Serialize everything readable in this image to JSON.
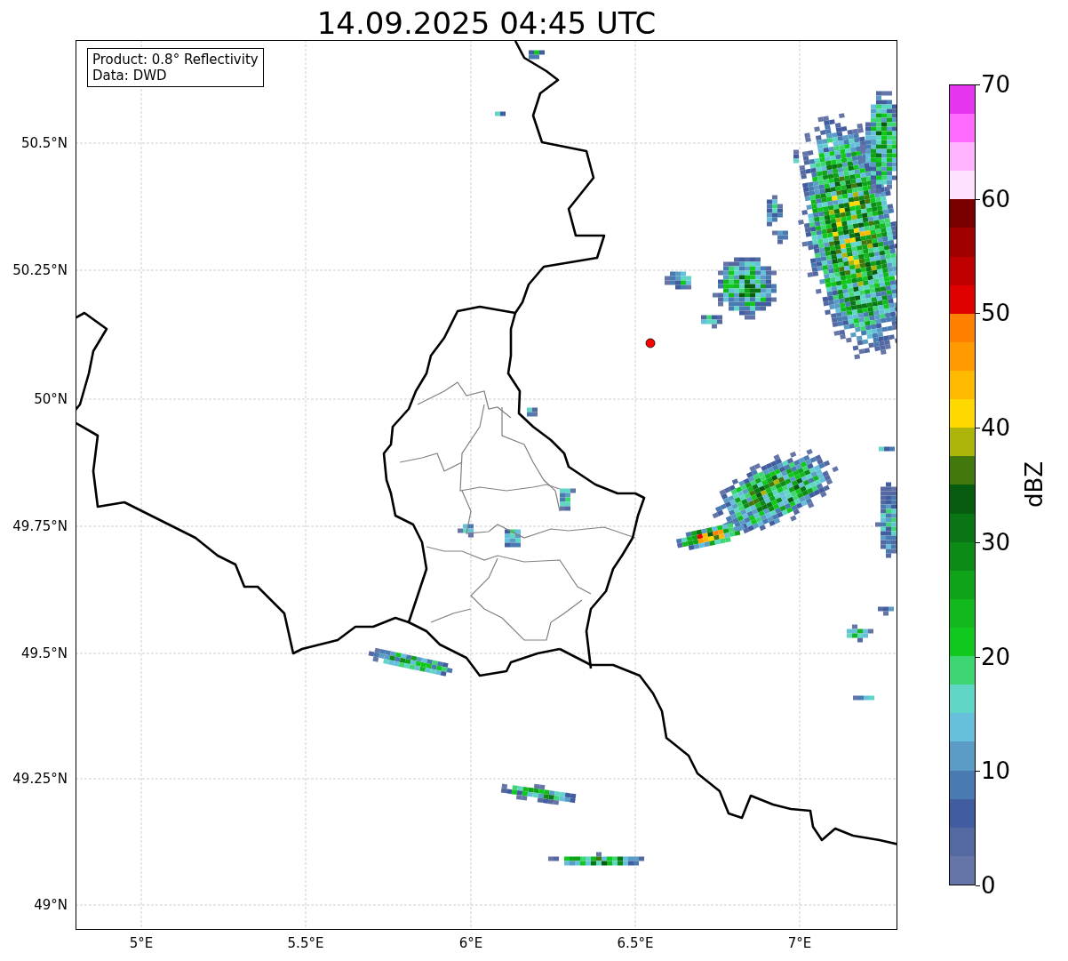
{
  "title": "14.09.2025 04:45 UTC",
  "info_box": {
    "lines": [
      "Product: 0.8° Reflectivity",
      "Data: DWD"
    ]
  },
  "map": {
    "x_ticks": [
      "5°E",
      "5.5°E",
      "6°E",
      "6.5°E",
      "7°E"
    ],
    "y_ticks": [
      "50.5°N",
      "50.25°N",
      "50°N",
      "49.75°N",
      "49.5°N",
      "49.25°N",
      "49°N"
    ]
  },
  "colorbar": {
    "label": "dBZ",
    "ticks": [
      "70",
      "60",
      "50",
      "40",
      "30",
      "20",
      "10",
      "0"
    ],
    "segments": [
      {
        "color": "#6675a8"
      },
      {
        "color": "#5468a2"
      },
      {
        "color": "#425ca0"
      },
      {
        "color": "#4a7ab2"
      },
      {
        "color": "#5b9cc6"
      },
      {
        "color": "#66c0dc"
      },
      {
        "color": "#5fd6c6"
      },
      {
        "color": "#3ed673"
      },
      {
        "color": "#11c81e"
      },
      {
        "color": "#12b81d"
      },
      {
        "color": "#0fa31a"
      },
      {
        "color": "#0c8c17"
      },
      {
        "color": "#0a7514"
      },
      {
        "color": "#075c10"
      },
      {
        "color": "#43780d"
      },
      {
        "color": "#adb40a"
      },
      {
        "color": "#ffd800"
      },
      {
        "color": "#ffb900"
      },
      {
        "color": "#ff9b00"
      },
      {
        "color": "#ff7f00"
      },
      {
        "color": "#e00000"
      },
      {
        "color": "#c00000"
      },
      {
        "color": "#a00000"
      },
      {
        "color": "#780000"
      },
      {
        "color": "#ffe0ff"
      },
      {
        "color": "#ffb4ff"
      },
      {
        "color": "#ff6aff"
      },
      {
        "color": "#e535ee"
      }
    ]
  }
}
